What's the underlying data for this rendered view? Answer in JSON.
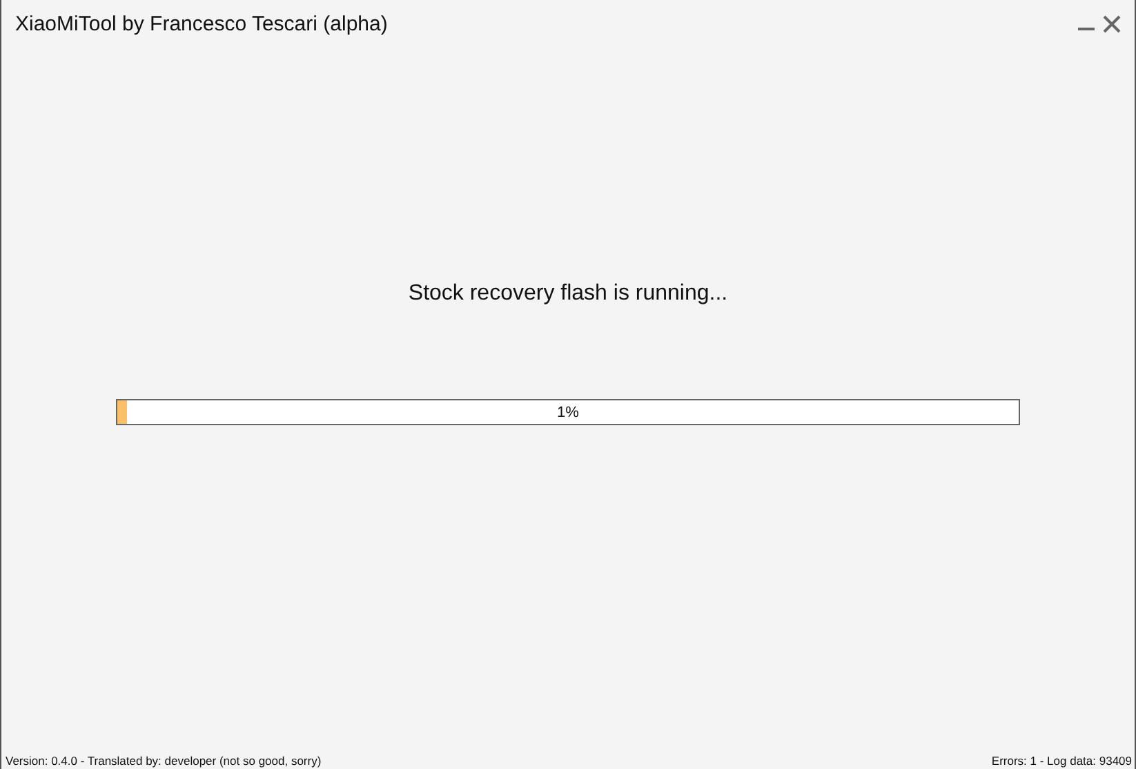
{
  "window": {
    "title": "XiaoMiTool by Francesco Tescari (alpha)"
  },
  "message": "Stock recovery flash is running...",
  "progress": {
    "level": 0.01,
    "reading": "1%"
  },
  "status_bar": {
    "left": "Version: 0.4.0 - Translated by: developer (not so good, sorry)",
    "right": "Errors: 1 - Log data: 93409"
  }
}
